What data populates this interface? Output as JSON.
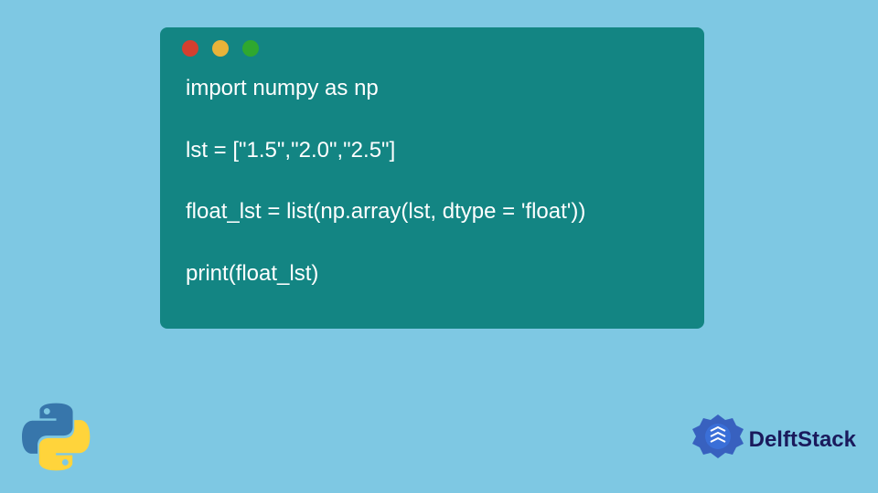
{
  "code": {
    "line1": "import numpy as np",
    "line2": "lst = [\"1.5\",\"2.0\",\"2.5\"]",
    "line3": "float_lst = list(np.array(lst, dtype = 'float'))",
    "line4": "print(float_lst)"
  },
  "branding": {
    "name": "DelftStack"
  }
}
